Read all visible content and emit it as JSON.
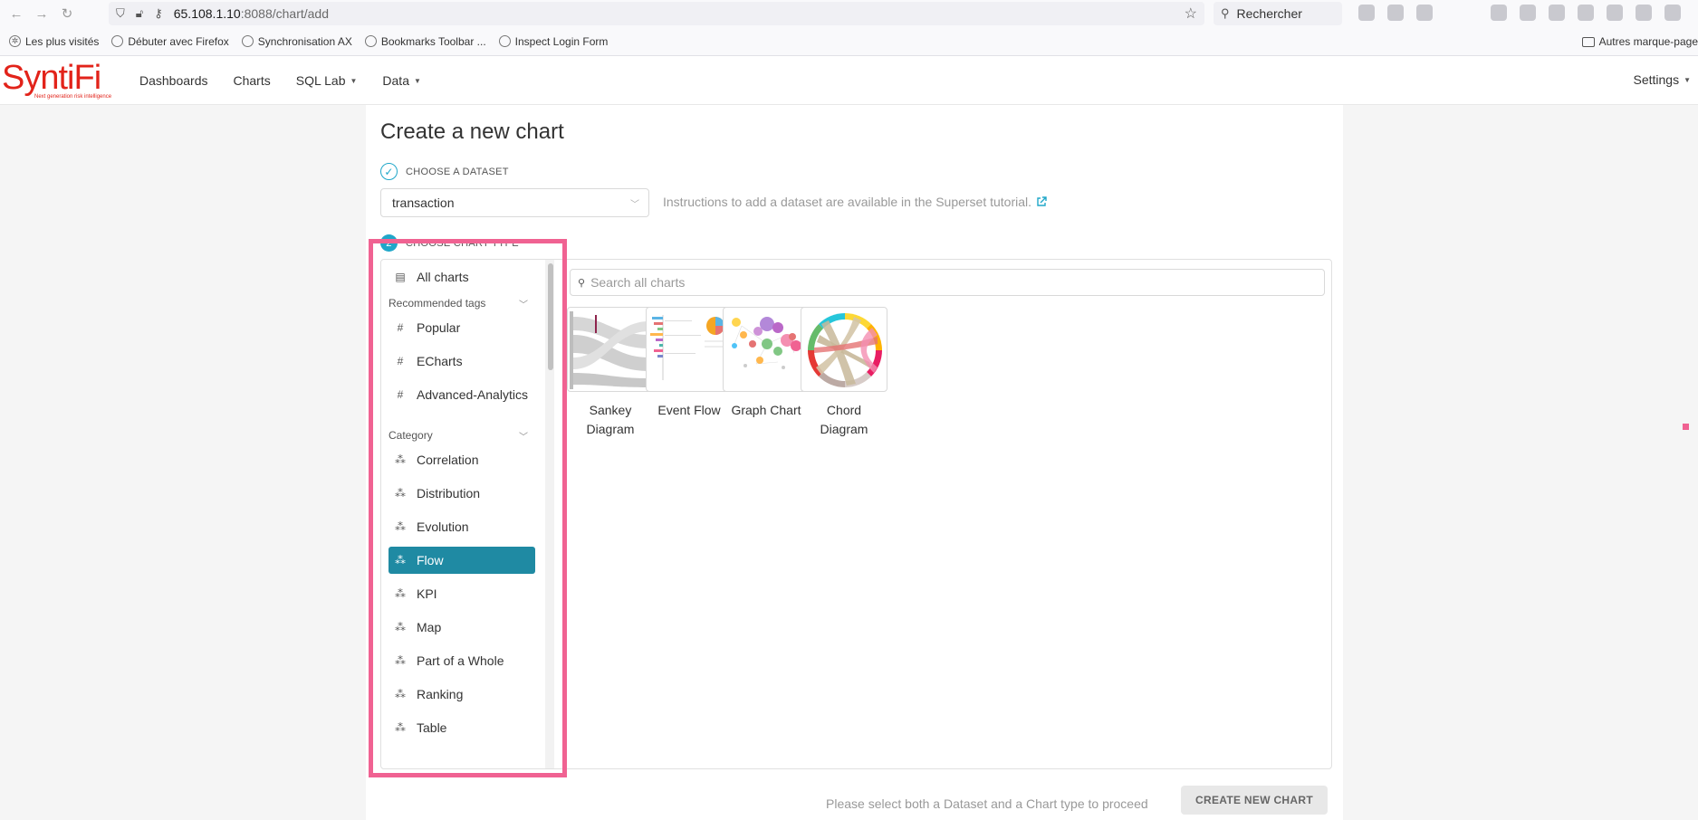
{
  "browser": {
    "url_host": "65.108.1.10",
    "url_path": ":8088/chart/add",
    "search_placeholder": "Rechercher",
    "bookmarks": [
      "Les plus visités",
      "Débuter avec Firefox",
      "Synchronisation AX",
      "Bookmarks Toolbar ...",
      "Inspect Login Form"
    ],
    "other_bookmarks": "Autres marque-page"
  },
  "app": {
    "logo_text": "SyntiFi",
    "logo_tagline": "Next generation risk intelligence",
    "nav": {
      "dashboards": "Dashboards",
      "charts": "Charts",
      "sql_lab": "SQL Lab",
      "data": "Data"
    },
    "settings": "Settings"
  },
  "page": {
    "title": "Create a new chart",
    "step1_label": "CHOOSE A DATASET",
    "dataset_value": "transaction",
    "instructions": "Instructions to add a dataset are available in the Superset tutorial.",
    "step2_number": "2",
    "step2_label": "CHOOSE CHART TYPE",
    "search_placeholder": "Search all charts",
    "footer_message": "Please select both a Dataset and a Chart type to proceed",
    "create_button": "CREATE NEW CHART"
  },
  "sidebar": {
    "all_charts": "All charts",
    "recommended_tags_label": "Recommended tags",
    "tags": [
      "Popular",
      "ECharts",
      "Advanced-Analytics"
    ],
    "category_label": "Category",
    "categories": [
      "Correlation",
      "Distribution",
      "Evolution",
      "Flow",
      "KPI",
      "Map",
      "Part of a Whole",
      "Ranking",
      "Table"
    ],
    "selected_category": "Flow"
  },
  "charts": [
    {
      "name_line1": "Sankey",
      "name_line2": "Diagram"
    },
    {
      "name_line1": "Event Flow",
      "name_line2": ""
    },
    {
      "name_line1": "Graph Chart",
      "name_line2": ""
    },
    {
      "name_line1": "Chord",
      "name_line2": "Diagram"
    }
  ],
  "colors": {
    "brand_red": "#e2231a",
    "accent_teal": "#20a7c9",
    "selected_bg": "#1f8aa3",
    "highlight_pink": "#f06292"
  }
}
